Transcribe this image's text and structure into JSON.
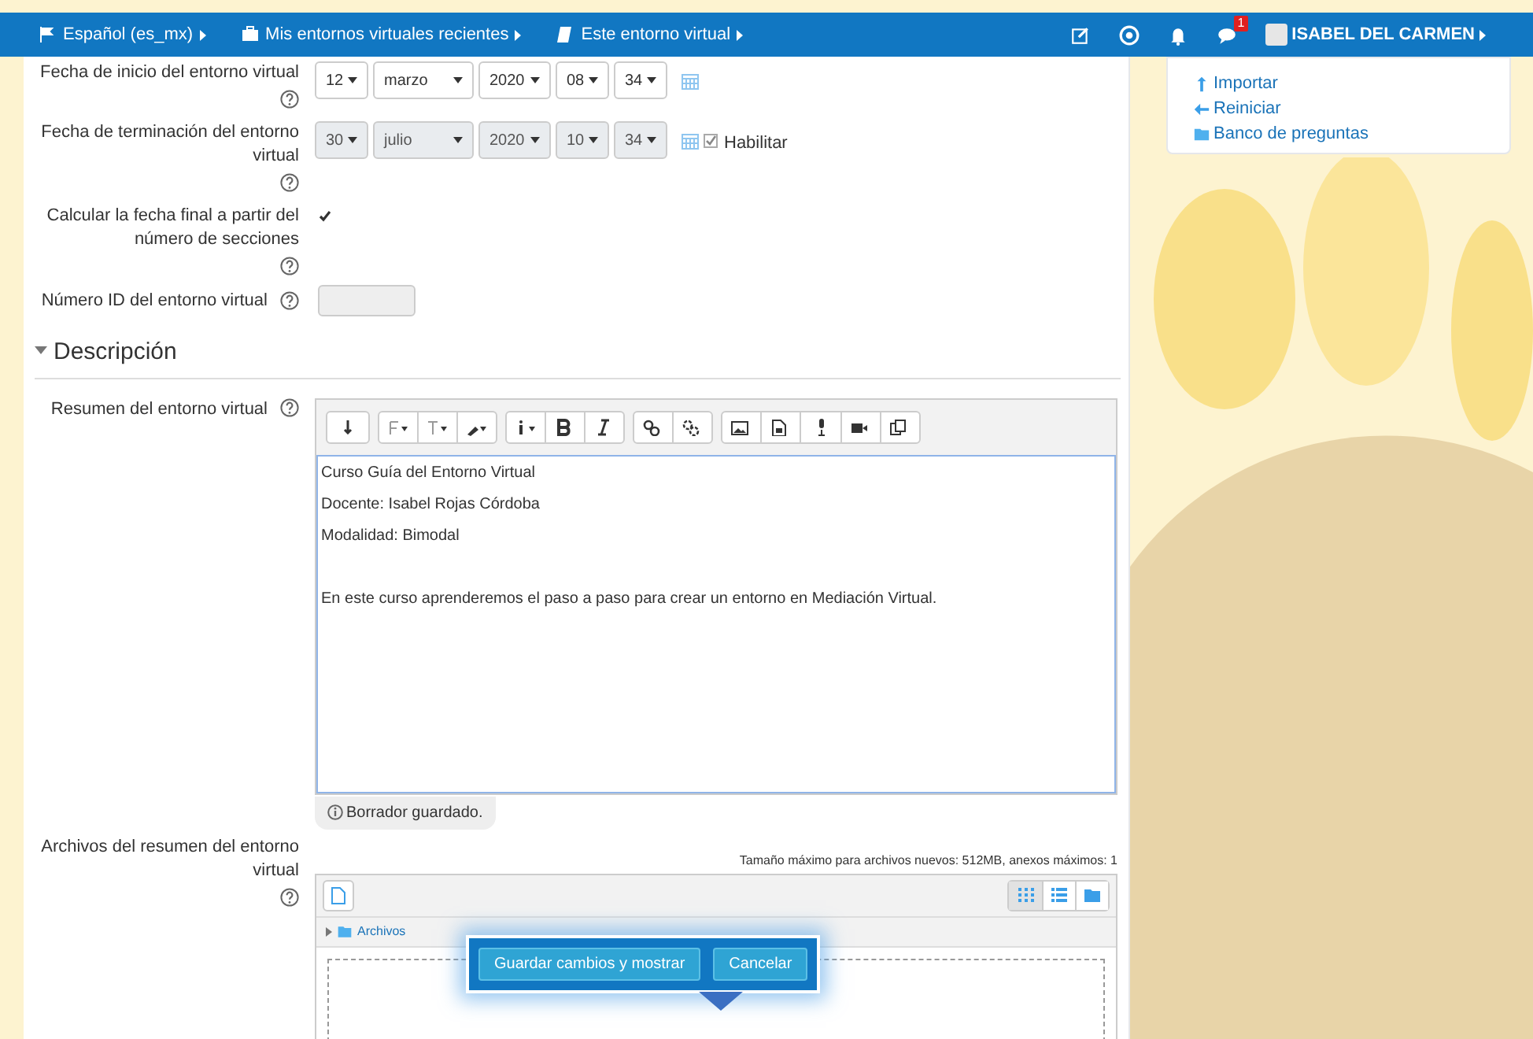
{
  "navbar": {
    "items": [
      {
        "kind": "flag",
        "label": "Español (es_mx)"
      },
      {
        "kind": "briefcase",
        "label": "Mis entornos virtuales recientes"
      },
      {
        "kind": "book",
        "label": "Este entorno virtual"
      }
    ],
    "icons": [
      {
        "kind": "edit"
      },
      {
        "kind": "accessibility"
      },
      {
        "kind": "bell"
      },
      {
        "kind": "chat",
        "badge": "1"
      }
    ],
    "user": "ISABEL DEL CARMEN"
  },
  "admin_block": {
    "links": [
      {
        "kind": "up",
        "label": "Importar"
      },
      {
        "kind": "back",
        "label": "Reiniciar"
      },
      {
        "kind": "folder",
        "label": "Banco de preguntas"
      }
    ]
  },
  "form": {
    "dates": [
      {
        "label": "Fecha de inicio del entorno virtual",
        "disabled": false,
        "day": "12",
        "month": "marzo",
        "year": "2020",
        "hour": "08",
        "minute": "34"
      },
      {
        "label": "Fecha de terminación del entorno virtual",
        "disabled": true,
        "day": "30",
        "month": "julio",
        "year": "2020",
        "hour": "10",
        "minute": "34",
        "enable": {
          "label": "Habilitar",
          "checked": true
        }
      }
    ],
    "calc": {
      "label": "Calcular la fecha final a partir del número de secciones",
      "checked": true
    },
    "idnumber": {
      "label": "Número ID del entorno virtual"
    },
    "section": {
      "title": "Descripción",
      "expanded": true
    },
    "summary": {
      "label": "Resumen del entorno virtual",
      "paragraphs": [
        {
          "text": "Curso Guía del Entorno Virtual",
          "space_before": false
        },
        {
          "text": "Docente: Isabel Rojas Córdoba",
          "space_before": false
        },
        {
          "text": "Modalidad: Bimodal",
          "space_before": false
        },
        {
          "text": "En este curso aprenderemos el paso a paso para crear un entorno en Mediación Virtual.",
          "space_before": true
        }
      ],
      "status": "Borrador guardado."
    },
    "files": {
      "label": "Archivos del resumen del entorno virtual",
      "limit": "Tamaño máximo para archivos nuevos: 512MB, anexos máximos: 1",
      "folder": "Archivos",
      "views": [
        {
          "kind": "grid",
          "selected": true
        },
        {
          "kind": "list",
          "selected": false
        },
        {
          "kind": "tree",
          "selected": false
        }
      ]
    }
  },
  "popup": {
    "buttons": [
      "Guardar cambios y mostrar",
      "Cancelar"
    ]
  }
}
